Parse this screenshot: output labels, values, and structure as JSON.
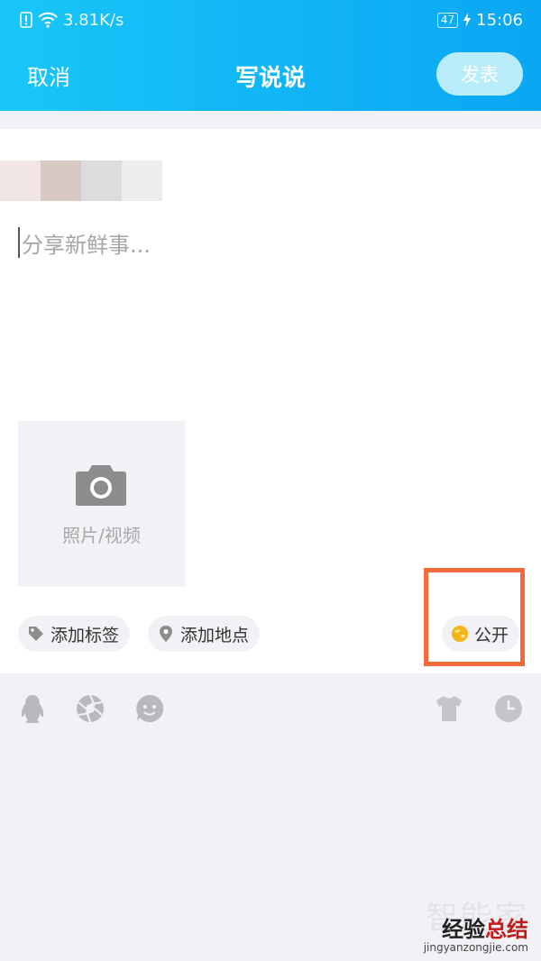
{
  "status_bar": {
    "net_speed": "3.81K/s",
    "battery": "47",
    "time": "15:06"
  },
  "header": {
    "cancel_label": "取消",
    "title": "写说说",
    "publish_label": "发表"
  },
  "composer": {
    "placeholder": "分享新鲜事..."
  },
  "media": {
    "label": "照片/视频",
    "icon": "camera-icon"
  },
  "chips": {
    "tag_label": "添加标签",
    "location_label": "添加地点",
    "visibility_label": "公开"
  },
  "toolbar": {
    "icons": [
      "qq-penguin-icon",
      "aperture-icon",
      "emoji-icon",
      "shirt-icon",
      "clock-icon"
    ]
  },
  "watermark": {
    "faint": "智能家",
    "brand_dark": "经验",
    "brand_red": "总结",
    "url": "jingyanzongjie.com"
  },
  "colors": {
    "header_gradient_start": "#19c6f8",
    "header_gradient_end": "#0aa6f3",
    "publish_button": "#b8ecfb",
    "highlight_box": "#f46a3d",
    "public_icon": "#f5b51a"
  }
}
